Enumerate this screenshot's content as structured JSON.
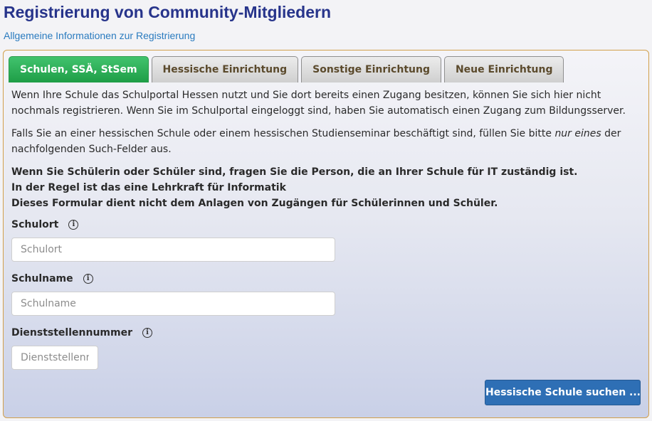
{
  "header": {
    "title": "Registrierung von Community-Mitgliedern",
    "info_link": "Allgemeine Informationen zur Registrierung"
  },
  "tabs": [
    {
      "label": "Schulen, SSÄ, StSem",
      "active": true
    },
    {
      "label": "Hessische Einrichtung",
      "active": false
    },
    {
      "label": "Sonstige Einrichtung",
      "active": false
    },
    {
      "label": "Neue Einrichtung",
      "active": false
    }
  ],
  "content": {
    "para1": "Wenn Ihre Schule das Schulportal Hessen nutzt und Sie dort bereits einen Zugang besitzen, können Sie sich hier nicht nochmals registrieren. Wenn Sie im Schulportal eingeloggt sind, haben Sie automatisch einen Zugang zum Bildungsserver.",
    "para2_before": "Falls Sie an einer hessischen Schule oder einem hessischen Studienseminar beschäftigt sind, füllen Sie bitte ",
    "para2_em": "nur eines",
    "para2_after": " der nachfolgenden Such-Felder aus.",
    "bold_lines": [
      "Wenn Sie Schülerin oder Schüler sind, fragen Sie die Person, die an Ihrer Schule für IT zuständig ist.",
      "In der Regel ist das eine Lehrkraft für Informatik",
      "Dieses Formular dient nicht dem Anlagen von Zugängen für Schülerinnen und Schüler."
    ]
  },
  "form": {
    "schulort": {
      "label": "Schulort",
      "placeholder": "Schulort",
      "value": ""
    },
    "schulname": {
      "label": "Schulname",
      "placeholder": "Schulname",
      "value": ""
    },
    "dienststellennummer": {
      "label": "Dienststellennummer",
      "placeholder": "Dienststellenn",
      "value": ""
    },
    "info_icon": "info-circle-icon",
    "submit_label": "Hessische Schule suchen ..."
  },
  "colors": {
    "title": "#27348b",
    "link": "#2a7bbf",
    "active_tab": "#2bb05a",
    "panel_border": "#d2a04c",
    "button": "#2e6fb5"
  }
}
